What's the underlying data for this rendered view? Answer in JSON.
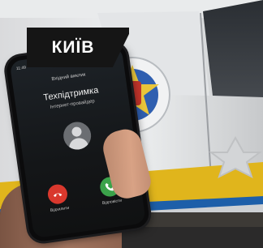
{
  "tag": {
    "text": "КИЇВ"
  },
  "phone": {
    "status_time": "11:49",
    "status_icons": "▂▄▆ ▮",
    "call_label": "Вхідний виклик",
    "caller_name": "Техпідтримка",
    "caller_subtitle": "Інтернет-провайдер",
    "decline_label": "Відхилити",
    "accept_label": "Відповісти"
  },
  "colors": {
    "decline": "#d9382d",
    "accept": "#3ba24a",
    "tag_bg": "#151515"
  }
}
